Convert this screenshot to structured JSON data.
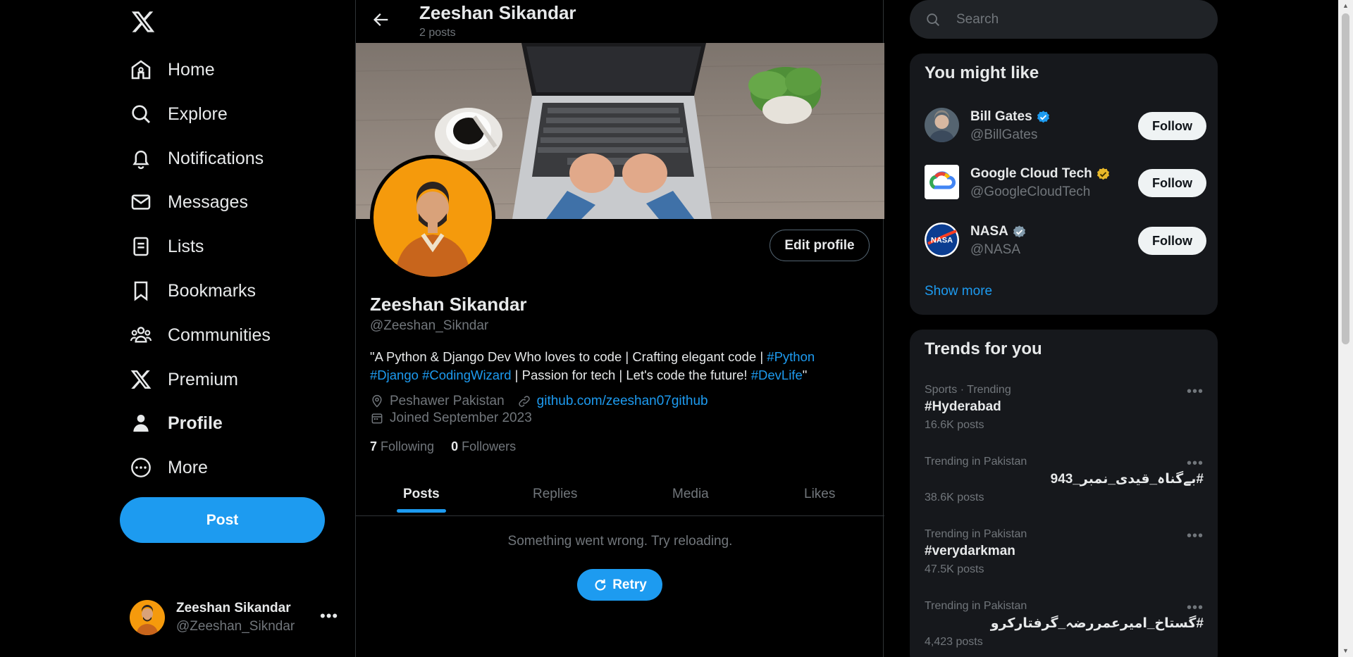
{
  "nav": {
    "items": [
      {
        "label": "Home",
        "icon": "home-icon"
      },
      {
        "label": "Explore",
        "icon": "search-icon"
      },
      {
        "label": "Notifications",
        "icon": "bell-icon"
      },
      {
        "label": "Messages",
        "icon": "envelope-icon"
      },
      {
        "label": "Lists",
        "icon": "list-icon"
      },
      {
        "label": "Bookmarks",
        "icon": "bookmark-icon"
      },
      {
        "label": "Communities",
        "icon": "people-icon"
      },
      {
        "label": "Premium",
        "icon": "x-logo-icon"
      },
      {
        "label": "Profile",
        "icon": "person-icon"
      },
      {
        "label": "More",
        "icon": "more-circle-icon"
      }
    ],
    "active": "Profile",
    "post_label": "Post"
  },
  "account": {
    "name": "Zeeshan Sikandar",
    "handle": "@Zeeshan_Sikndar"
  },
  "header": {
    "title": "Zeeshan Sikandar",
    "posts_count": "2 posts"
  },
  "profile": {
    "name": "Zeeshan Sikandar",
    "handle": "@Zeeshan_Sikndar",
    "edit_label": "Edit profile",
    "bio": {
      "p1": "\"A Python & Django Dev Who loves to code | Crafting elegant code | ",
      "t1": "#Python",
      "t2": "#Django",
      "t3": "#CodingWizard",
      "p2": " | Passion for tech | Let's code the future!  ",
      "t4": "#DevLife",
      "p3": "\""
    },
    "location": "Peshawer Pakistan",
    "website": "github.com/zeeshan07github",
    "joined": "Joined September 2023",
    "following_count": "7",
    "following_label": "Following",
    "followers_count": "0",
    "followers_label": "Followers"
  },
  "tabs": [
    "Posts",
    "Replies",
    "Media",
    "Likes"
  ],
  "active_tab": "Posts",
  "feed": {
    "error": "Something went wrong. Try reloading.",
    "retry_label": "Retry"
  },
  "search": {
    "placeholder": "Search"
  },
  "who_to_follow": {
    "title": "You might like",
    "accounts": [
      {
        "name": "Bill Gates",
        "handle": "@BillGates",
        "badge": "blue-verified",
        "follow": "Follow"
      },
      {
        "name": "Google Cloud Tech",
        "handle": "@GoogleCloudTech",
        "badge": "gold-verified",
        "follow": "Follow"
      },
      {
        "name": "NASA",
        "handle": "@NASA",
        "badge": "gray-verified",
        "follow": "Follow"
      }
    ],
    "show_more": "Show more"
  },
  "trends": {
    "title": "Trends for you",
    "items": [
      {
        "context": "Sports · Trending",
        "name": "#Hyderabad",
        "count": "16.6K posts"
      },
      {
        "context": "Trending in Pakistan",
        "name": "#بےگناہ_قیدی_نمبر_943",
        "count": "38.6K posts"
      },
      {
        "context": "Trending in Pakistan",
        "name": "#verydarkman",
        "count": "47.5K posts"
      },
      {
        "context": "Trending in Pakistan",
        "name": "#گستاخ_امیرعمررضہ_گرفتارکرو",
        "count": "4,423 posts"
      }
    ]
  },
  "colors": {
    "accent": "#1d9bf0",
    "background": "#000000",
    "card": "#16181c",
    "muted": "#71767b",
    "verified_gold": "#e8b829"
  }
}
